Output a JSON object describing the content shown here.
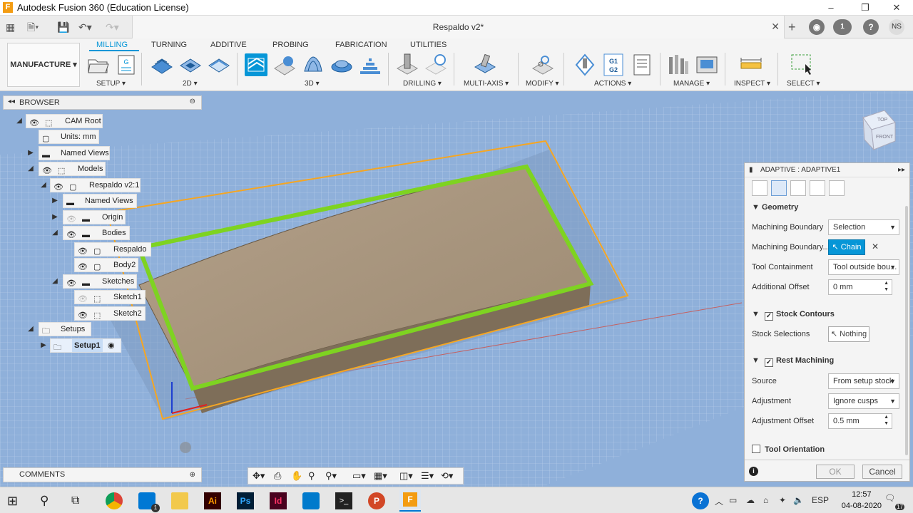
{
  "window": {
    "title": "Autodesk Fusion 360 (Education License)",
    "min": "–",
    "max": "❐",
    "close": "✕"
  },
  "doc": {
    "name": "Respaldo v2*",
    "close": "✕",
    "avatar": "NS",
    "jobs": "1"
  },
  "ribbon": {
    "workspace": "MANUFACTURE",
    "tabs": [
      "MILLING",
      "TURNING",
      "ADDITIVE",
      "PROBING",
      "FABRICATION",
      "UTILITIES"
    ],
    "groups": [
      "SETUP",
      "2D",
      "3D",
      "DRILLING",
      "MULTI-AXIS",
      "MODIFY",
      "ACTIONS",
      "MANAGE",
      "INSPECT",
      "SELECT"
    ]
  },
  "browser": {
    "title": "BROWSER",
    "nodes": [
      "CAM Root",
      "Units: mm",
      "Named Views",
      "Models",
      "Respaldo v2:1",
      "Named Views",
      "Origin",
      "Bodies",
      "Respaldo",
      "Body2",
      "Sketches",
      "Sketch1",
      "Sketch2",
      "Setups",
      "Setup1"
    ]
  },
  "comments": {
    "title": "COMMENTS"
  },
  "viewcube": {
    "top": "TOP",
    "front": "FRONT"
  },
  "panel": {
    "title": "ADAPTIVE : ADAPTIVE1",
    "geometry": "Geometry",
    "machining_boundary_label": "Machining Boundary",
    "machining_boundary_value": "Selection",
    "boundary_sel_label": "Machining Boundary...",
    "chain": "Chain",
    "tool_containment_label": "Tool Containment",
    "tool_containment_value": "Tool outside bou...",
    "additional_offset_label": "Additional Offset",
    "additional_offset_value": "0 mm",
    "stock_contours": "Stock Contours",
    "stock_selections_label": "Stock Selections",
    "stock_selections_value": "Nothing",
    "rest_machining": "Rest Machining",
    "source_label": "Source",
    "source_value": "From setup stock",
    "adjustment_label": "Adjustment",
    "adjustment_value": "Ignore cusps",
    "adj_offset_label": "Adjustment Offset",
    "adj_offset_value": "0.5 mm",
    "tool_orientation": "Tool Orientation",
    "ok": "OK",
    "cancel": "Cancel"
  },
  "taskbar": {
    "lang": "ESP",
    "time": "12:57",
    "date": "04-08-2020",
    "notif": "17",
    "mail_badge": "1"
  },
  "colors": {
    "accent": "#0696d7",
    "boundary": "#7ed321",
    "stock": "#f5a623"
  }
}
